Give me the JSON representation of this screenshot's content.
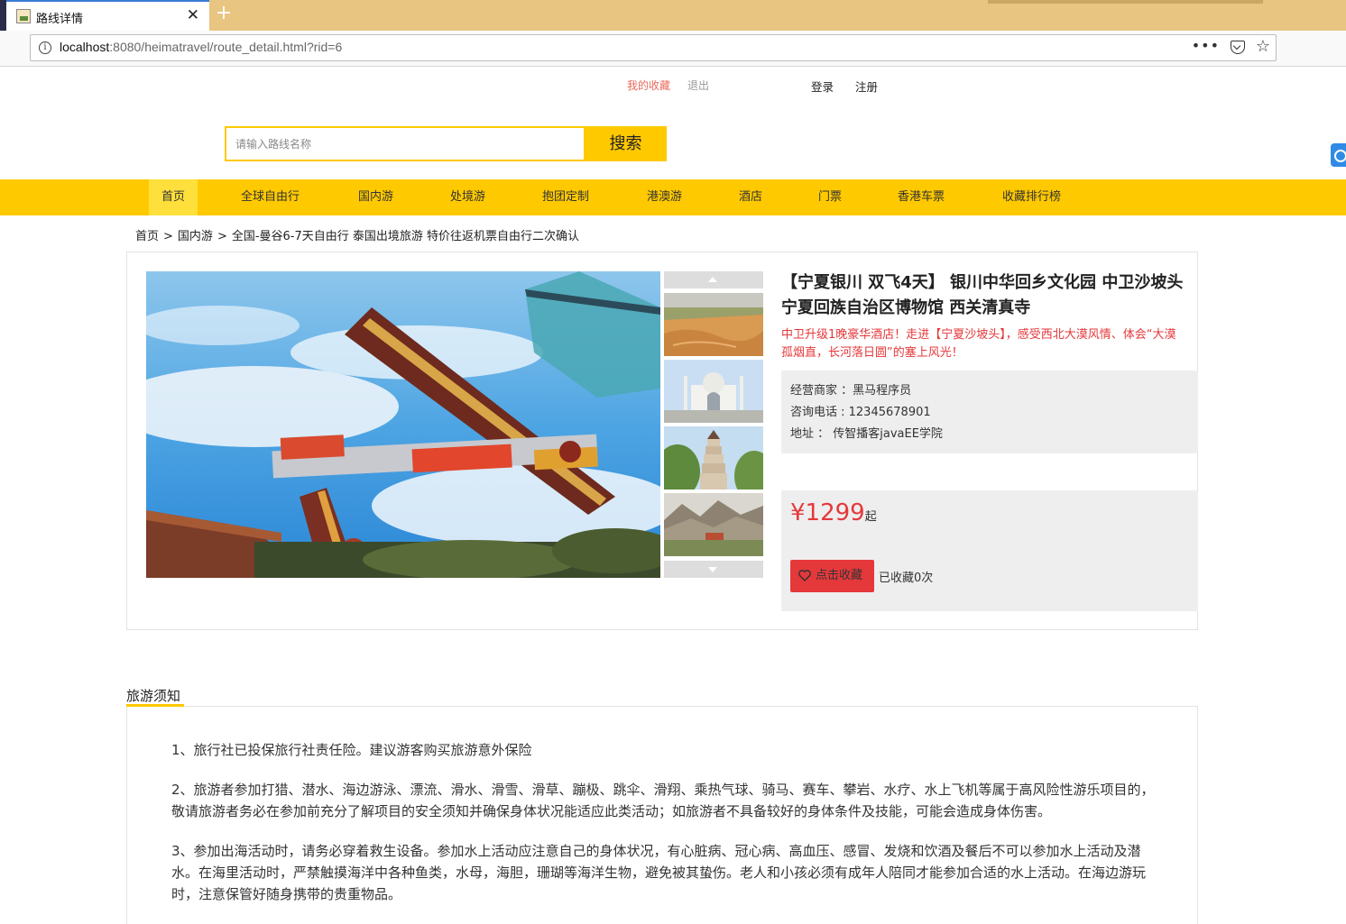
{
  "browser": {
    "tab_title": "路线详情",
    "url_host": "localhost",
    "url_rest": ":8080/heimatravel/route_detail.html?rid=6",
    "url_more": "•••"
  },
  "header": {
    "my_favorites": "我的收藏",
    "logout": "退出",
    "login": "登录",
    "register": "注册",
    "search_placeholder": "请输入路线名称",
    "search_button": "搜索"
  },
  "nav": {
    "items": [
      "首页",
      "全球自由行",
      "国内游",
      "处境游",
      "抱团定制",
      "港澳游",
      "酒店",
      "门票",
      "香港车票",
      "收藏排行榜"
    ],
    "active": "首页"
  },
  "breadcrumb": {
    "items": [
      "首页",
      "国内游",
      "全国-曼谷6-7天自由行 泰国出境旅游 特价往返机票自由行二次确认"
    ],
    "separator": ">"
  },
  "route": {
    "title": "【宁夏银川 双飞4天】 银川中华回乡文化园 中卫沙坡头 宁夏回族自治区博物馆 西关清真寺",
    "intro": "中卫升级1晚豪华酒店！走进【宁夏沙坡头】，感受西北大漠风情、体会“大漠孤烟直，长河落日圆”的塞上风光！",
    "seller": "经营商家 ：黑马程序员",
    "phone": "咨询电话 : 12345678901",
    "address": "地址 ： 传智播客javaEE学院",
    "price": "¥1299",
    "price_suffix": "起",
    "favorite_button": "点击收藏",
    "favorite_count": "已收藏0次",
    "accent_color": "#e5383b",
    "theme_color": "#ffc900"
  },
  "notice": {
    "title": "旅游须知",
    "paragraphs": [
      "1、旅行社已投保旅行社责任险。建议游客购买旅游意外保险",
      "2、旅游者参加打猎、潜水、海边游泳、漂流、滑水、滑雪、滑草、蹦极、跳伞、滑翔、乘热气球、骑马、赛车、攀岩、水疗、水上飞机等属于高风险性游乐项目的，敬请旅游者务必在参加前充分了解项目的安全须知并确保身体状况能适应此类活动；如旅游者不具备较好的身体条件及技能，可能会造成身体伤害。",
      "3、参加出海活动时，请务必穿着救生设备。参加水上活动应注意自己的身体状况，有心脏病、冠心病、高血压、感冒、发烧和饮酒及餐后不可以参加水上活动及潜水。在海里活动时，严禁触摸海洋中各种鱼类，水母，海胆，珊瑚等海洋生物，避免被其蛰伤。老人和小孩必须有成年人陪同才能参加合适的水上活动。在海边游玩时，注意保管好随身携带的贵重物品。"
    ]
  }
}
